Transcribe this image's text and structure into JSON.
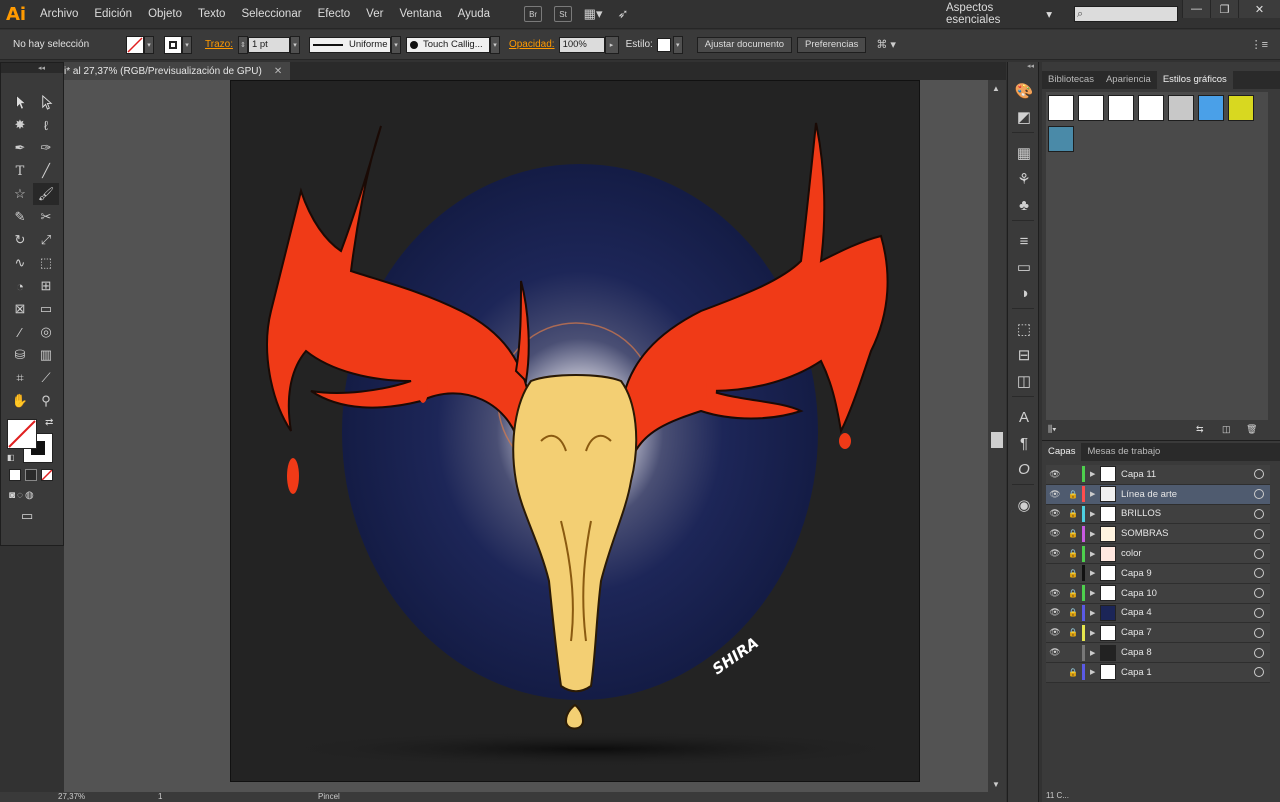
{
  "app": {
    "logo": "Ai"
  },
  "menu": [
    "Archivo",
    "Edición",
    "Objeto",
    "Texto",
    "Seleccionar",
    "Efecto",
    "Ver",
    "Ventana",
    "Ayuda"
  ],
  "menubar_icons": {
    "bridge": "Br",
    "stock": "St"
  },
  "workspace": {
    "label": "Aspectos esenciales",
    "chevron": "▾"
  },
  "window_controls": {
    "minimize": "—",
    "restore": "❐",
    "close": "✕"
  },
  "control_bar": {
    "selection_status": "No hay selección",
    "stroke_label": "Trazo:",
    "stroke_weight": "1 pt",
    "profile": "Uniforme",
    "brush": "Touch Callig...",
    "opacity_label": "Opacidad:",
    "opacity": "100%",
    "style_label": "Estilo:",
    "doc_setup_btn": "Ajustar documento",
    "prefs_btn": "Preferencias"
  },
  "document": {
    "tab_title": "i* al 27,37% (RGB/Previsualización de GPU)",
    "close": "✕"
  },
  "artwork": {
    "signature": "SHIRA",
    "accent_red": "#f03a17",
    "bone_yellow": "#f3cf73",
    "halo_blue": "#1b2557",
    "background": "#232323"
  },
  "status_bar": {
    "zoom": "27,37%",
    "page": "1",
    "mode": "Pincel"
  },
  "styles_panel": {
    "tabs": [
      "Bibliotecas",
      "Apariencia",
      "Estilos gráficos"
    ],
    "active_tab": "Estilos gráficos"
  },
  "layers_panel": {
    "tabs": [
      "Capas",
      "Mesas de trabajo"
    ],
    "active_tab": "Capas",
    "footer": "11 C...",
    "layers": [
      {
        "name": "Capa 11",
        "visible": true,
        "locked": false,
        "color": "#4dd04d",
        "thumb": "#ffffff",
        "selected": false
      },
      {
        "name": "Línea de arte",
        "visible": true,
        "locked": true,
        "color": "#ff4d4d",
        "thumb": "#f0f0f0",
        "selected": true
      },
      {
        "name": "BRILLOS",
        "visible": true,
        "locked": true,
        "color": "#4dd0e0",
        "thumb": "#ffffff",
        "selected": false
      },
      {
        "name": "SOMBRAS",
        "visible": true,
        "locked": true,
        "color": "#c85ae0",
        "thumb": "#fff4e0",
        "selected": false
      },
      {
        "name": "color",
        "visible": true,
        "locked": true,
        "color": "#4dd04d",
        "thumb": "#ffe8e0",
        "selected": false
      },
      {
        "name": "Capa 9",
        "visible": false,
        "locked": true,
        "color": "#111111",
        "thumb": "#ffffff",
        "selected": false
      },
      {
        "name": "Capa 10",
        "visible": true,
        "locked": true,
        "color": "#4dd04d",
        "thumb": "#ffffff",
        "selected": false
      },
      {
        "name": "Capa 4",
        "visible": true,
        "locked": true,
        "color": "#5a5ae6",
        "thumb": "#1b2557",
        "selected": false
      },
      {
        "name": "Capa 7",
        "visible": true,
        "locked": true,
        "color": "#e6e64d",
        "thumb": "#ffffff",
        "selected": false
      },
      {
        "name": "Capa 8",
        "visible": true,
        "locked": false,
        "color": "#777777",
        "thumb": "#222222",
        "selected": false
      },
      {
        "name": "Capa 1",
        "visible": false,
        "locked": true,
        "color": "#5a5ae6",
        "thumb": "#ffffff",
        "selected": false
      }
    ]
  }
}
